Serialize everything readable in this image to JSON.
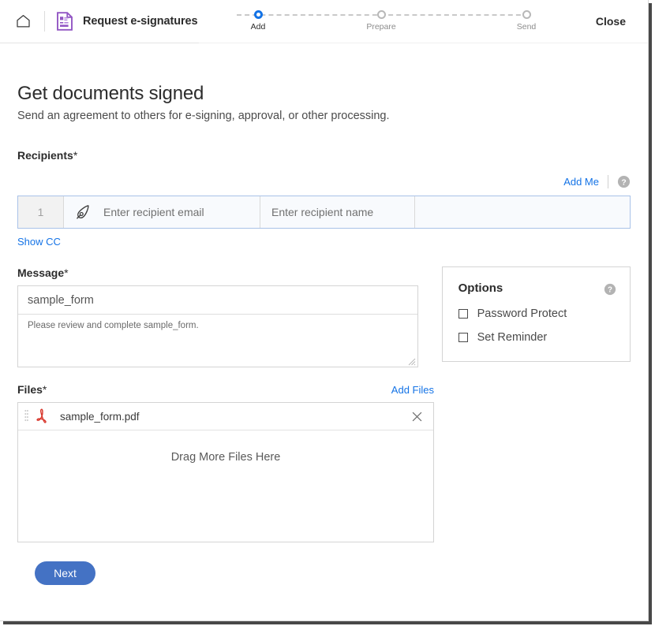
{
  "header": {
    "home_icon": "home-icon",
    "doc_icon": "e-signature-document-icon",
    "title": "Request e-signatures",
    "close_label": "Close",
    "accent_blue": "#1473e6",
    "doc_icon_color": "#9256c4"
  },
  "stepper": {
    "steps": [
      {
        "label": "Add",
        "active": true
      },
      {
        "label": "Prepare",
        "active": false
      },
      {
        "label": "Send",
        "active": false
      }
    ]
  },
  "page": {
    "title": "Get documents signed",
    "subtitle": "Send an agreement to others for e-signing, approval, or other processing."
  },
  "recipients": {
    "label": "Recipients",
    "required_mark": "*",
    "add_me_label": "Add Me",
    "help_icon": "help-circle-icon",
    "rows": [
      {
        "index": "1",
        "role_icon": "pen-nib-icon",
        "email_placeholder": "Enter recipient email",
        "name_placeholder": "Enter recipient name",
        "email_value": "",
        "name_value": ""
      }
    ],
    "show_cc_label": "Show CC"
  },
  "message": {
    "label": "Message",
    "required_mark": "*",
    "subject_value": "sample_form",
    "body_value": "Please review and complete sample_form."
  },
  "options": {
    "title": "Options",
    "help_icon": "help-circle-icon",
    "items": [
      {
        "label": "Password Protect",
        "checked": false
      },
      {
        "label": "Set Reminder",
        "checked": false
      }
    ]
  },
  "files": {
    "label": "Files",
    "required_mark": "*",
    "add_files_label": "Add Files",
    "items": [
      {
        "name": "sample_form.pdf",
        "file_icon": "pdf-icon",
        "remove_icon": "close-x-icon",
        "drag_icon": "drag-handle-icon"
      }
    ],
    "dropzone_label": "Drag More Files Here"
  },
  "footer": {
    "next_label": "Next",
    "next_color": "#4472c4"
  }
}
